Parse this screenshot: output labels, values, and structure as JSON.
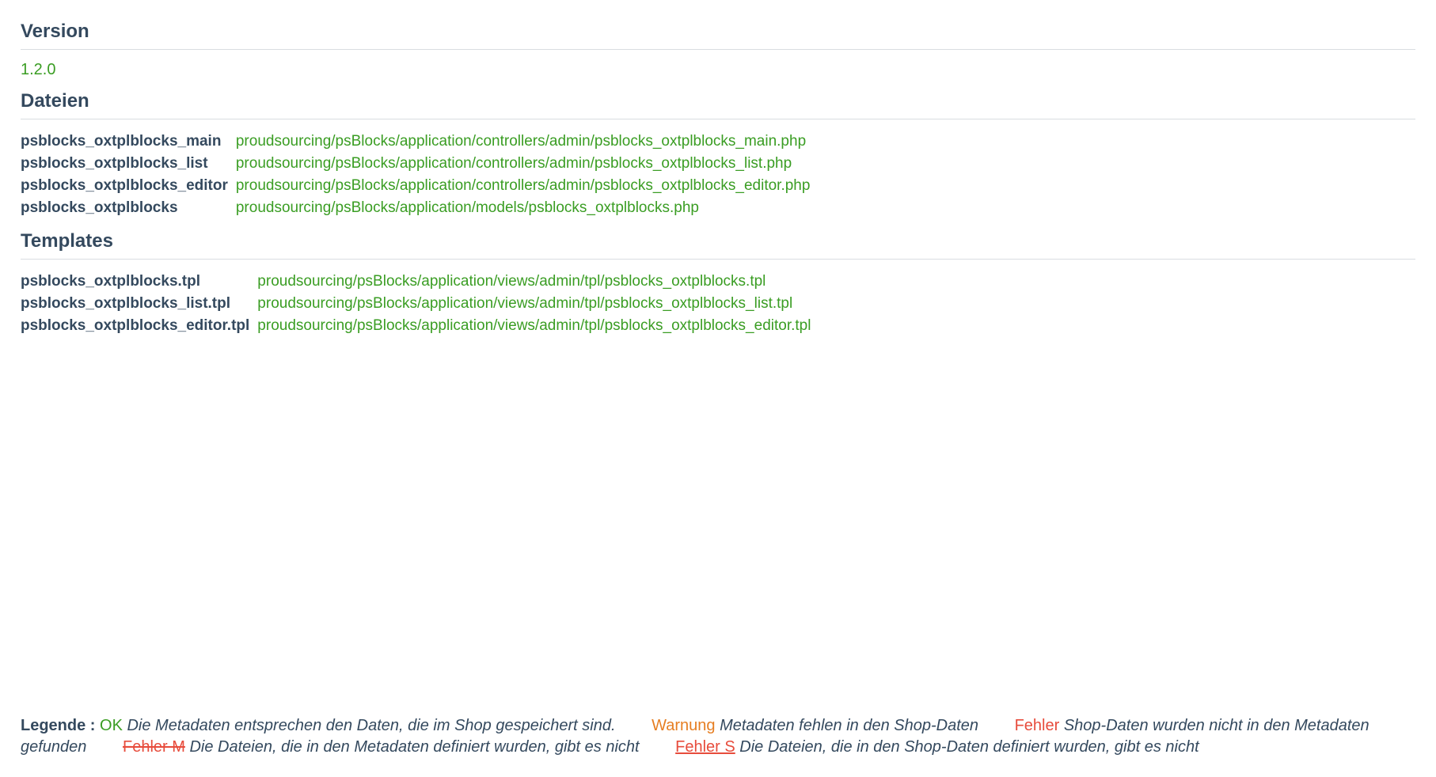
{
  "sections": {
    "version": {
      "heading": "Version",
      "value": "1.2.0"
    },
    "files": {
      "heading": "Dateien",
      "rows": [
        {
          "key": "psblocks_oxtplblocks_main",
          "val": "proudsourcing/psBlocks/application/controllers/admin/psblocks_oxtplblocks_main.php"
        },
        {
          "key": "psblocks_oxtplblocks_list",
          "val": "proudsourcing/psBlocks/application/controllers/admin/psblocks_oxtplblocks_list.php"
        },
        {
          "key": "psblocks_oxtplblocks_editor",
          "val": "proudsourcing/psBlocks/application/controllers/admin/psblocks_oxtplblocks_editor.php"
        },
        {
          "key": "psblocks_oxtplblocks",
          "val": "proudsourcing/psBlocks/application/models/psblocks_oxtplblocks.php"
        }
      ]
    },
    "templates": {
      "heading": "Templates",
      "rows": [
        {
          "key": "psblocks_oxtplblocks.tpl",
          "val": "proudsourcing/psBlocks/application/views/admin/tpl/psblocks_oxtplblocks.tpl"
        },
        {
          "key": "psblocks_oxtplblocks_list.tpl",
          "val": "proudsourcing/psBlocks/application/views/admin/tpl/psblocks_oxtplblocks_list.tpl"
        },
        {
          "key": "psblocks_oxtplblocks_editor.tpl",
          "val": "proudsourcing/psBlocks/application/views/admin/tpl/psblocks_oxtplblocks_editor.tpl"
        }
      ]
    }
  },
  "legend": {
    "label": "Legende :",
    "ok": {
      "tag": "OK",
      "desc": "Die Metadaten entsprechen den Daten, die im Shop gespeichert sind."
    },
    "warn": {
      "tag": "Warnung",
      "desc": "Metadaten fehlen in den Shop-Daten"
    },
    "err": {
      "tag": "Fehler",
      "desc": "Shop-Daten wurden nicht in den Metadaten gefunden"
    },
    "err_m": {
      "tag": "Fehler M",
      "desc": "Die Dateien, die in den Metadaten definiert wurden, gibt es nicht"
    },
    "err_s": {
      "tag": "Fehler S",
      "desc": "Die Dateien, die in den Shop-Daten definiert wurden, gibt es nicht"
    }
  }
}
